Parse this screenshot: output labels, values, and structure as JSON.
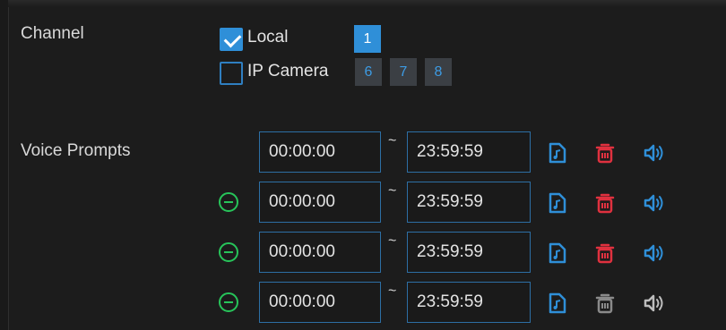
{
  "channel": {
    "label": "Channel",
    "local": {
      "label": "Local",
      "checked": true,
      "channels": [
        "1"
      ]
    },
    "ip_camera": {
      "label": "IP Camera",
      "checked": false,
      "channels": [
        "6",
        "7",
        "8"
      ]
    }
  },
  "voice_prompts": {
    "label": "Voice Prompts",
    "separator": "~",
    "rows": [
      {
        "start": "00:00:00",
        "end": "23:59:59",
        "removable": false,
        "trash_enabled": true
      },
      {
        "start": "00:00:00",
        "end": "23:59:59",
        "removable": true,
        "trash_enabled": true
      },
      {
        "start": "00:00:00",
        "end": "23:59:59",
        "removable": true,
        "trash_enabled": true
      },
      {
        "start": "00:00:00",
        "end": "23:59:59",
        "removable": true,
        "trash_enabled": false
      }
    ]
  },
  "colors": {
    "accent_blue": "#2f8fd8",
    "delete_red": "#e0313f",
    "disabled_gray": "#8a8a8a",
    "remove_green": "#27c45a"
  },
  "icons": [
    "file-audio-icon",
    "trash-icon",
    "speaker-icon",
    "minus-circle-icon",
    "checkmark-icon"
  ]
}
